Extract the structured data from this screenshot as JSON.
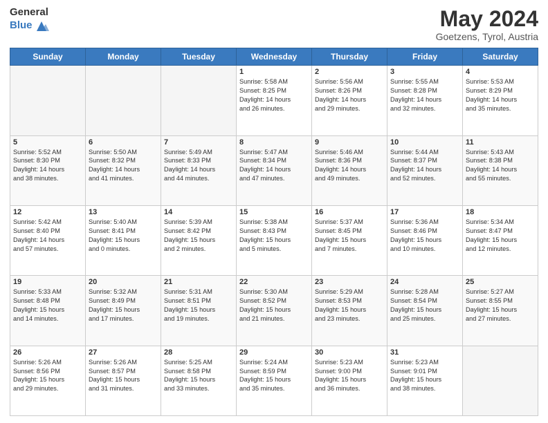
{
  "header": {
    "logo_general": "General",
    "logo_blue": "Blue",
    "title": "May 2024",
    "subtitle": "Goetzens, Tyrol, Austria"
  },
  "days_of_week": [
    "Sunday",
    "Monday",
    "Tuesday",
    "Wednesday",
    "Thursday",
    "Friday",
    "Saturday"
  ],
  "weeks": [
    [
      {
        "day": "",
        "info": ""
      },
      {
        "day": "",
        "info": ""
      },
      {
        "day": "",
        "info": ""
      },
      {
        "day": "1",
        "info": "Sunrise: 5:58 AM\nSunset: 8:25 PM\nDaylight: 14 hours\nand 26 minutes."
      },
      {
        "day": "2",
        "info": "Sunrise: 5:56 AM\nSunset: 8:26 PM\nDaylight: 14 hours\nand 29 minutes."
      },
      {
        "day": "3",
        "info": "Sunrise: 5:55 AM\nSunset: 8:28 PM\nDaylight: 14 hours\nand 32 minutes."
      },
      {
        "day": "4",
        "info": "Sunrise: 5:53 AM\nSunset: 8:29 PM\nDaylight: 14 hours\nand 35 minutes."
      }
    ],
    [
      {
        "day": "5",
        "info": "Sunrise: 5:52 AM\nSunset: 8:30 PM\nDaylight: 14 hours\nand 38 minutes."
      },
      {
        "day": "6",
        "info": "Sunrise: 5:50 AM\nSunset: 8:32 PM\nDaylight: 14 hours\nand 41 minutes."
      },
      {
        "day": "7",
        "info": "Sunrise: 5:49 AM\nSunset: 8:33 PM\nDaylight: 14 hours\nand 44 minutes."
      },
      {
        "day": "8",
        "info": "Sunrise: 5:47 AM\nSunset: 8:34 PM\nDaylight: 14 hours\nand 47 minutes."
      },
      {
        "day": "9",
        "info": "Sunrise: 5:46 AM\nSunset: 8:36 PM\nDaylight: 14 hours\nand 49 minutes."
      },
      {
        "day": "10",
        "info": "Sunrise: 5:44 AM\nSunset: 8:37 PM\nDaylight: 14 hours\nand 52 minutes."
      },
      {
        "day": "11",
        "info": "Sunrise: 5:43 AM\nSunset: 8:38 PM\nDaylight: 14 hours\nand 55 minutes."
      }
    ],
    [
      {
        "day": "12",
        "info": "Sunrise: 5:42 AM\nSunset: 8:40 PM\nDaylight: 14 hours\nand 57 minutes."
      },
      {
        "day": "13",
        "info": "Sunrise: 5:40 AM\nSunset: 8:41 PM\nDaylight: 15 hours\nand 0 minutes."
      },
      {
        "day": "14",
        "info": "Sunrise: 5:39 AM\nSunset: 8:42 PM\nDaylight: 15 hours\nand 2 minutes."
      },
      {
        "day": "15",
        "info": "Sunrise: 5:38 AM\nSunset: 8:43 PM\nDaylight: 15 hours\nand 5 minutes."
      },
      {
        "day": "16",
        "info": "Sunrise: 5:37 AM\nSunset: 8:45 PM\nDaylight: 15 hours\nand 7 minutes."
      },
      {
        "day": "17",
        "info": "Sunrise: 5:36 AM\nSunset: 8:46 PM\nDaylight: 15 hours\nand 10 minutes."
      },
      {
        "day": "18",
        "info": "Sunrise: 5:34 AM\nSunset: 8:47 PM\nDaylight: 15 hours\nand 12 minutes."
      }
    ],
    [
      {
        "day": "19",
        "info": "Sunrise: 5:33 AM\nSunset: 8:48 PM\nDaylight: 15 hours\nand 14 minutes."
      },
      {
        "day": "20",
        "info": "Sunrise: 5:32 AM\nSunset: 8:49 PM\nDaylight: 15 hours\nand 17 minutes."
      },
      {
        "day": "21",
        "info": "Sunrise: 5:31 AM\nSunset: 8:51 PM\nDaylight: 15 hours\nand 19 minutes."
      },
      {
        "day": "22",
        "info": "Sunrise: 5:30 AM\nSunset: 8:52 PM\nDaylight: 15 hours\nand 21 minutes."
      },
      {
        "day": "23",
        "info": "Sunrise: 5:29 AM\nSunset: 8:53 PM\nDaylight: 15 hours\nand 23 minutes."
      },
      {
        "day": "24",
        "info": "Sunrise: 5:28 AM\nSunset: 8:54 PM\nDaylight: 15 hours\nand 25 minutes."
      },
      {
        "day": "25",
        "info": "Sunrise: 5:27 AM\nSunset: 8:55 PM\nDaylight: 15 hours\nand 27 minutes."
      }
    ],
    [
      {
        "day": "26",
        "info": "Sunrise: 5:26 AM\nSunset: 8:56 PM\nDaylight: 15 hours\nand 29 minutes."
      },
      {
        "day": "27",
        "info": "Sunrise: 5:26 AM\nSunset: 8:57 PM\nDaylight: 15 hours\nand 31 minutes."
      },
      {
        "day": "28",
        "info": "Sunrise: 5:25 AM\nSunset: 8:58 PM\nDaylight: 15 hours\nand 33 minutes."
      },
      {
        "day": "29",
        "info": "Sunrise: 5:24 AM\nSunset: 8:59 PM\nDaylight: 15 hours\nand 35 minutes."
      },
      {
        "day": "30",
        "info": "Sunrise: 5:23 AM\nSunset: 9:00 PM\nDaylight: 15 hours\nand 36 minutes."
      },
      {
        "day": "31",
        "info": "Sunrise: 5:23 AM\nSunset: 9:01 PM\nDaylight: 15 hours\nand 38 minutes."
      },
      {
        "day": "",
        "info": ""
      }
    ]
  ]
}
